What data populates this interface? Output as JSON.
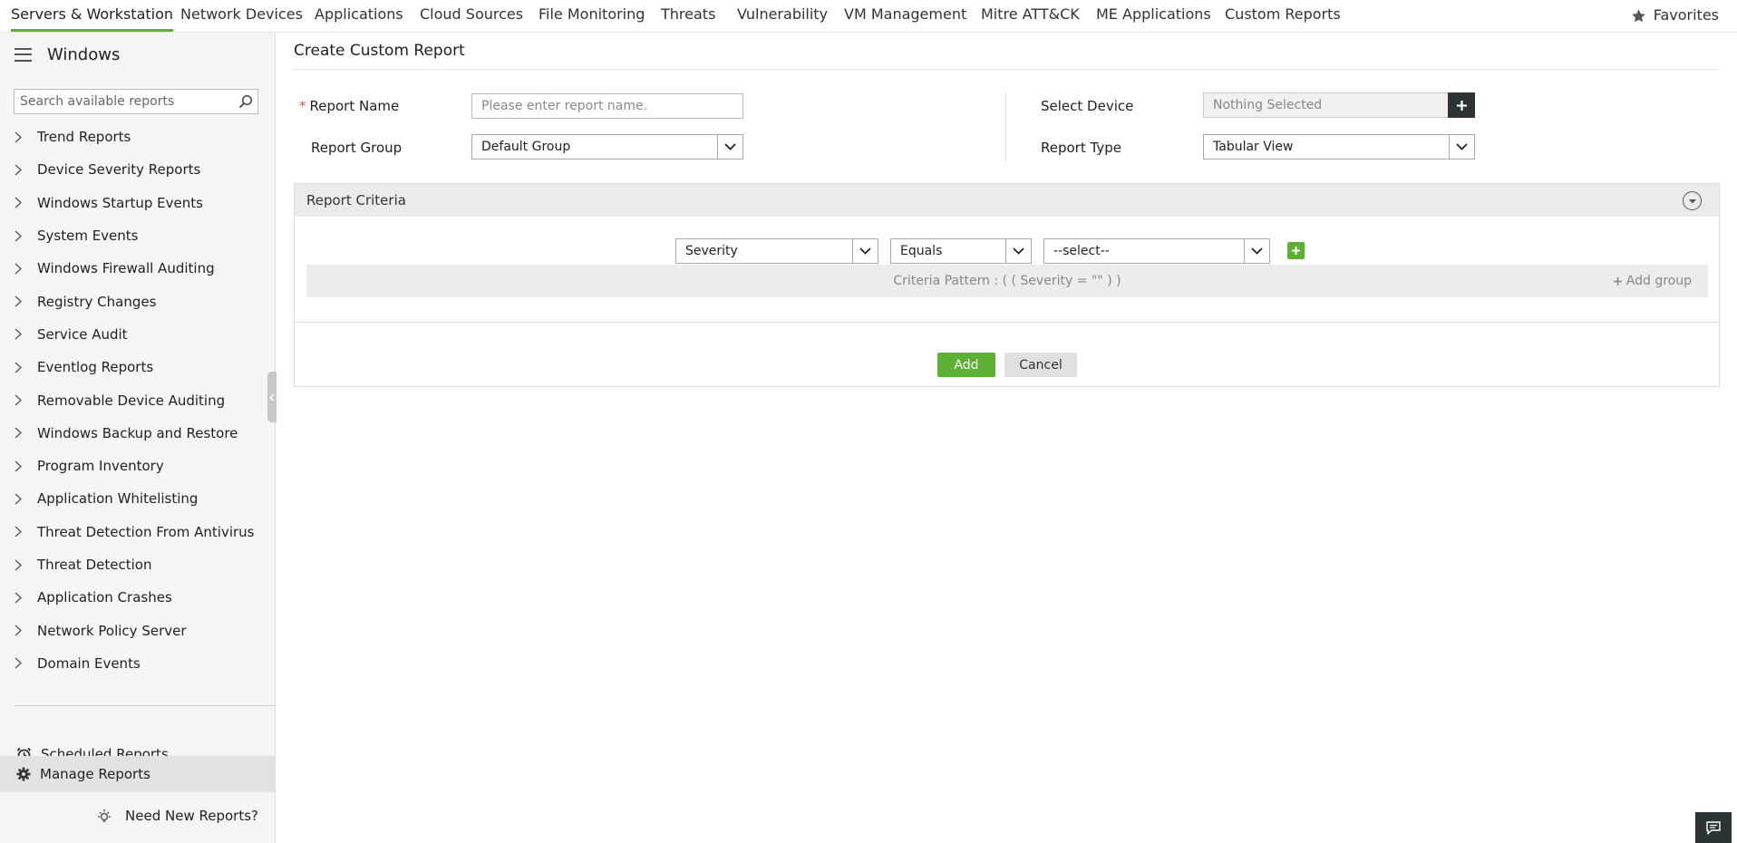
{
  "topnav": {
    "tabs": [
      {
        "label": "Servers & Workstation",
        "active": true
      },
      {
        "label": "Network Devices"
      },
      {
        "label": "Applications"
      },
      {
        "label": "Cloud Sources"
      },
      {
        "label": "File Monitoring"
      },
      {
        "label": "Threats"
      },
      {
        "label": "Vulnerability"
      },
      {
        "label": "VM Management"
      },
      {
        "label": "Mitre ATT&CK"
      },
      {
        "label": "ME Applications"
      },
      {
        "label": "Custom Reports"
      }
    ],
    "favorites_label": "Favorites"
  },
  "sidebar": {
    "title": "Windows",
    "search_placeholder": "Search available reports",
    "items": [
      {
        "label": "Trend Reports"
      },
      {
        "label": "Device Severity Reports"
      },
      {
        "label": "Windows Startup Events"
      },
      {
        "label": "System Events"
      },
      {
        "label": "Windows Firewall Auditing"
      },
      {
        "label": "Registry Changes"
      },
      {
        "label": "Service Audit"
      },
      {
        "label": "Eventlog Reports"
      },
      {
        "label": "Removable Device Auditing"
      },
      {
        "label": "Windows Backup and Restore"
      },
      {
        "label": "Program Inventory"
      },
      {
        "label": "Application Whitelisting"
      },
      {
        "label": "Threat Detection From Antivirus"
      },
      {
        "label": "Threat Detection"
      },
      {
        "label": "Application Crashes"
      },
      {
        "label": "Network Policy Server"
      },
      {
        "label": "Domain Events"
      }
    ],
    "scheduled_reports": "Scheduled Reports",
    "manage_reports": "Manage Reports",
    "need_new_reports": "Need New Reports?"
  },
  "main": {
    "title": "Create Custom Report",
    "report_name_required": "*",
    "report_name_label": "Report Name",
    "report_name_placeholder": "Please enter report name.",
    "report_name_value": "",
    "report_group_label": "Report Group",
    "report_group_value": "Default Group",
    "select_device_label": "Select Device",
    "select_device_value": "Nothing Selected",
    "report_type_label": "Report Type",
    "report_type_value": "Tabular View",
    "criteria": {
      "title": "Report Criteria",
      "field_value": "Severity",
      "operator_value": "Equals",
      "value_value": "--select--",
      "pattern_text": "Criteria Pattern : ( ( Severity = \"\" ) )",
      "add_group_label": "Add group"
    },
    "add_button": "Add",
    "cancel_button": "Cancel"
  },
  "colors": {
    "accent_green": "#5cb033",
    "dark_button": "#2d3436"
  }
}
